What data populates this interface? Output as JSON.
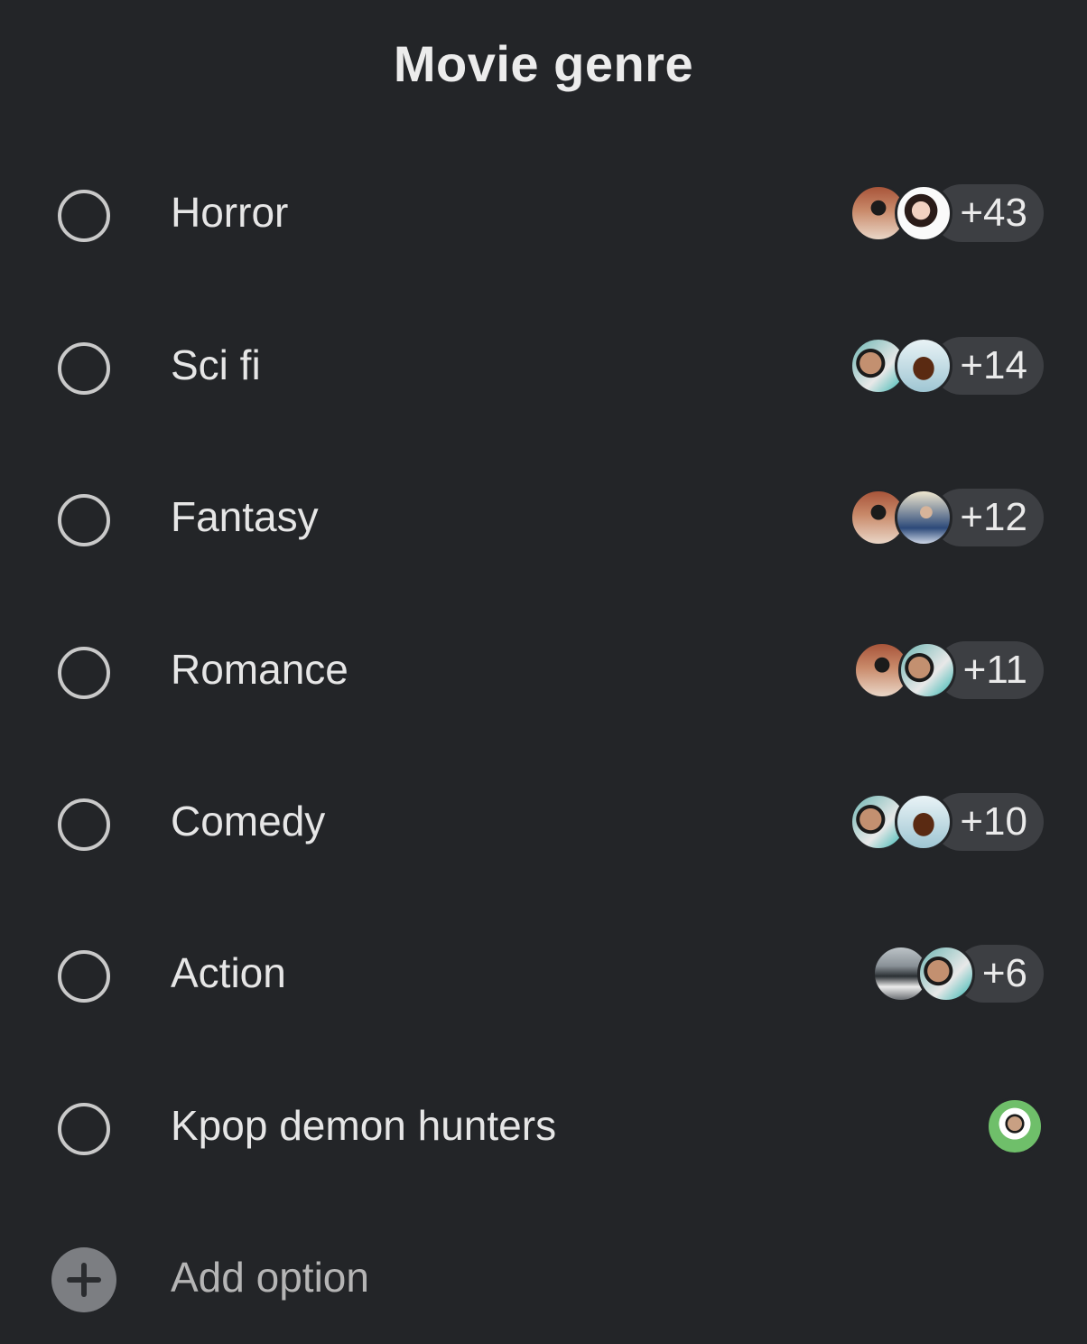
{
  "poll": {
    "title": "Movie genre",
    "options": [
      {
        "label": "Horror",
        "avatars": [
          "av-a",
          "av-b"
        ],
        "count": "+43"
      },
      {
        "label": "Sci fi",
        "avatars": [
          "av-c",
          "av-d"
        ],
        "count": "+14"
      },
      {
        "label": "Fantasy",
        "avatars": [
          "av-a",
          "av-e"
        ],
        "count": "+12"
      },
      {
        "label": "Romance",
        "avatars": [
          "av-a",
          "av-c"
        ],
        "count": "+11"
      },
      {
        "label": "Comedy",
        "avatars": [
          "av-c",
          "av-d"
        ],
        "count": "+10"
      },
      {
        "label": "Action",
        "avatars": [
          "av-f",
          "av-c"
        ],
        "count": "+6"
      },
      {
        "label": "Kpop demon hunters",
        "avatars": [
          "av-g"
        ],
        "count": null
      }
    ],
    "add_option_label": "Add option"
  }
}
